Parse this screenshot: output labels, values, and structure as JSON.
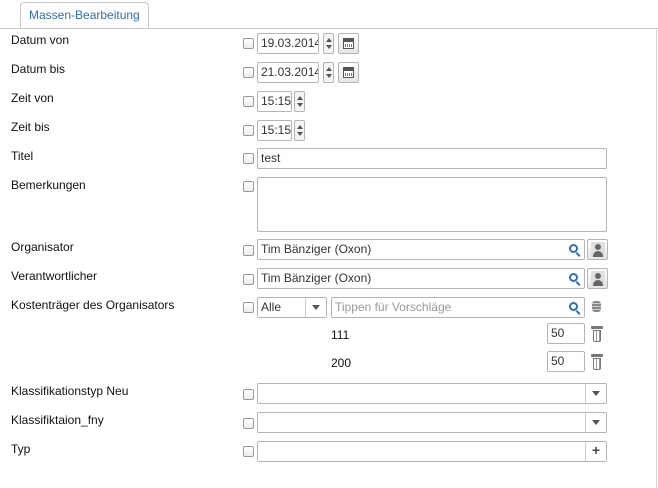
{
  "tab": {
    "label": "Massen-Bearbeitung"
  },
  "fields": {
    "datum_von": {
      "label": "Datum von",
      "value": "19.03.2014"
    },
    "datum_bis": {
      "label": "Datum bis",
      "value": "21.03.2014"
    },
    "zeit_von": {
      "label": "Zeit von",
      "value": "15:15"
    },
    "zeit_bis": {
      "label": "Zeit bis",
      "value": "15:15"
    },
    "titel": {
      "label": "Titel",
      "value": "test"
    },
    "bemerkungen": {
      "label": "Bemerkungen",
      "value": ""
    },
    "organisator": {
      "label": "Organisator",
      "value": "Tim Bänziger (Oxon)"
    },
    "verantwortlicher": {
      "label": "Verantwortlicher",
      "value": "Tim Bänziger (Oxon)"
    },
    "kostentraeger": {
      "label": "Kostenträger des Organisators",
      "filter": "Alle",
      "placeholder": "Tippen für Vorschläge",
      "rows": [
        {
          "code": "111",
          "amount": "50"
        },
        {
          "code": "200",
          "amount": "50"
        }
      ]
    },
    "klassifikationstyp": {
      "label": "Klassifikationstyp Neu",
      "value": ""
    },
    "klassifiktaion_fny": {
      "label": "Klassifiktaion_fny",
      "value": ""
    },
    "typ": {
      "label": "Typ",
      "value": ""
    }
  },
  "colors": {
    "accent": "#2f6fb5",
    "border": "#b5b5b5"
  }
}
